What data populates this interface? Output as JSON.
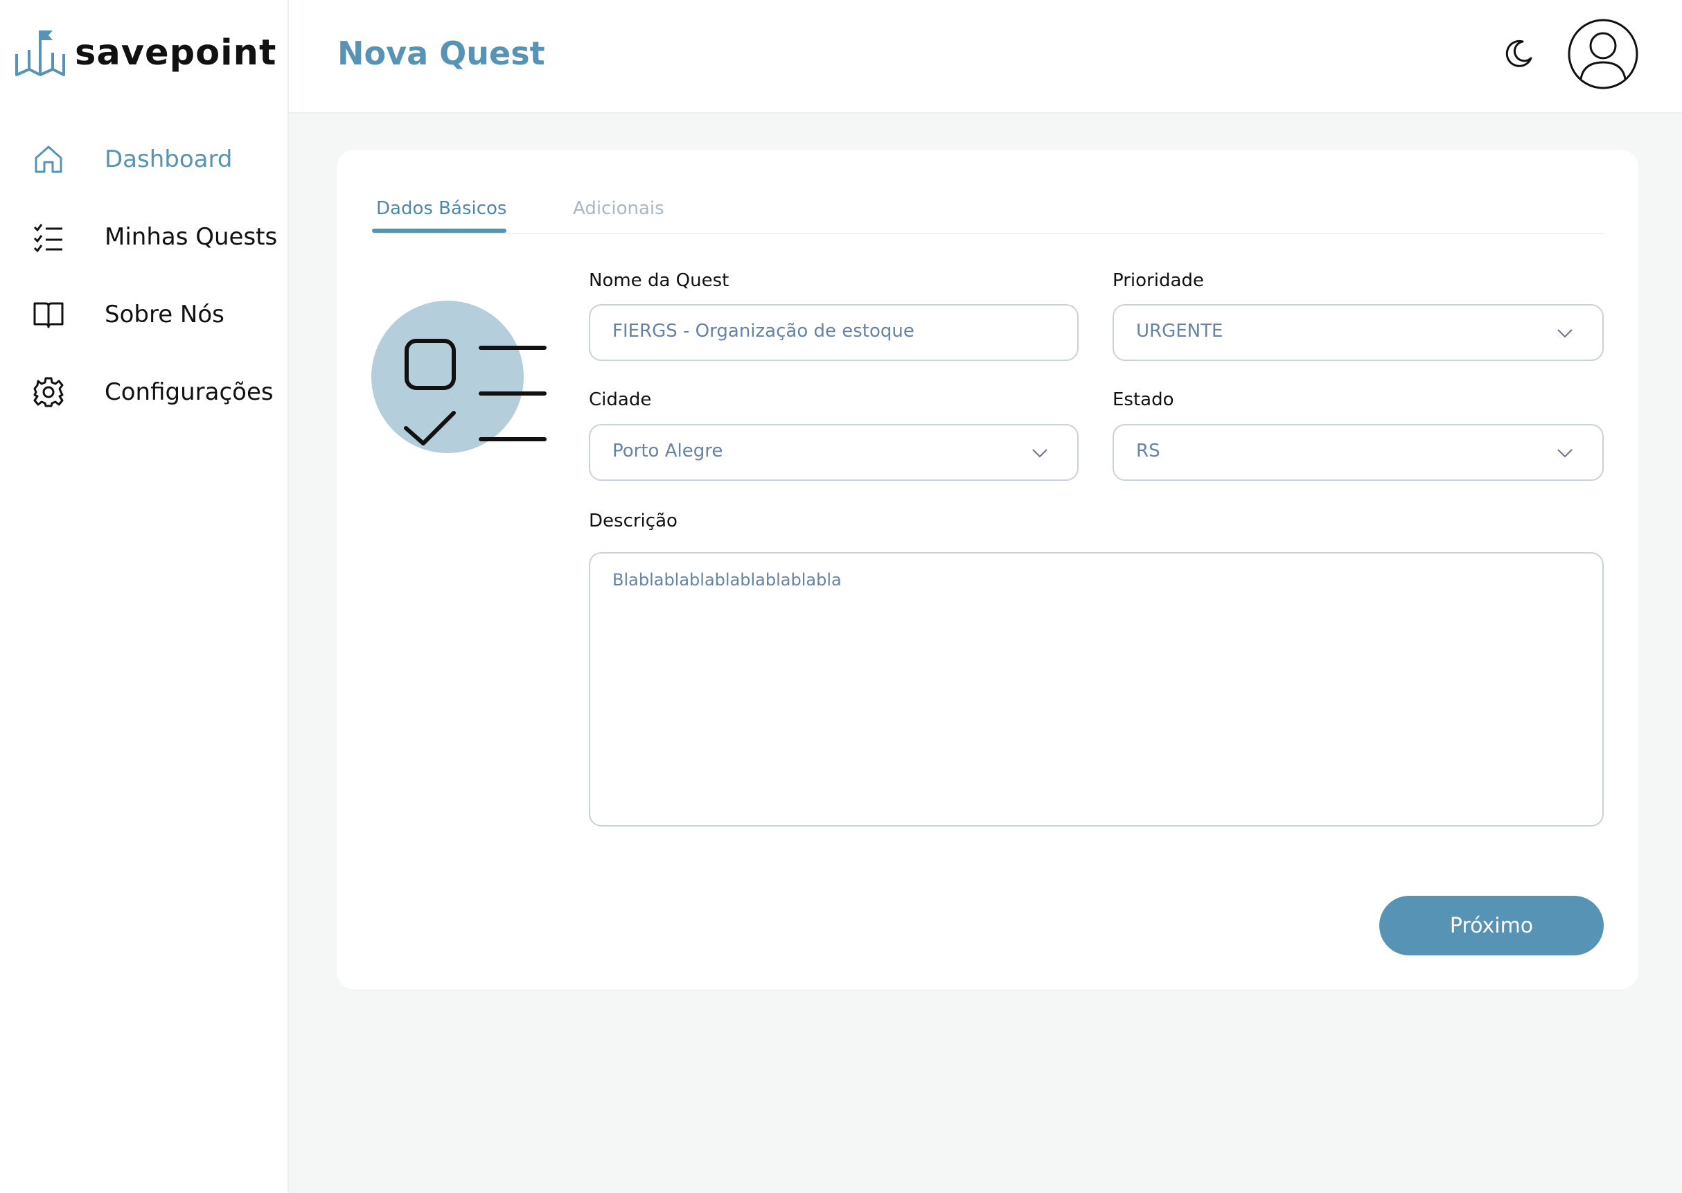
{
  "brand": {
    "name": "savepoint",
    "accent": "#5693b4"
  },
  "sidebar": {
    "items": [
      {
        "label": "Dashboard",
        "icon": "home-icon",
        "active": true
      },
      {
        "label": "Minhas Quests",
        "icon": "checklist-icon",
        "active": false
      },
      {
        "label": "Sobre Nós",
        "icon": "book-icon",
        "active": false
      },
      {
        "label": "Configurações",
        "icon": "gear-icon",
        "active": false
      }
    ]
  },
  "header": {
    "title": "Nova Quest",
    "theme_icon": "moon-icon",
    "avatar_icon": "user-icon"
  },
  "tabs": [
    {
      "label": "Dados Básicos",
      "active": true
    },
    {
      "label": "Adicionais",
      "active": false
    }
  ],
  "form": {
    "nome": {
      "label": "Nome da Quest",
      "value": "FIERGS - Organização de estoque"
    },
    "prioridade": {
      "label": "Prioridade",
      "value": "URGENTE"
    },
    "cidade": {
      "label": "Cidade",
      "value": "Porto Alegre"
    },
    "estado": {
      "label": "Estado",
      "value": "RS"
    },
    "descricao": {
      "label": "Descrição",
      "value": "Blablablablablablablablabla"
    }
  },
  "actions": {
    "next_label": "Próximo"
  }
}
